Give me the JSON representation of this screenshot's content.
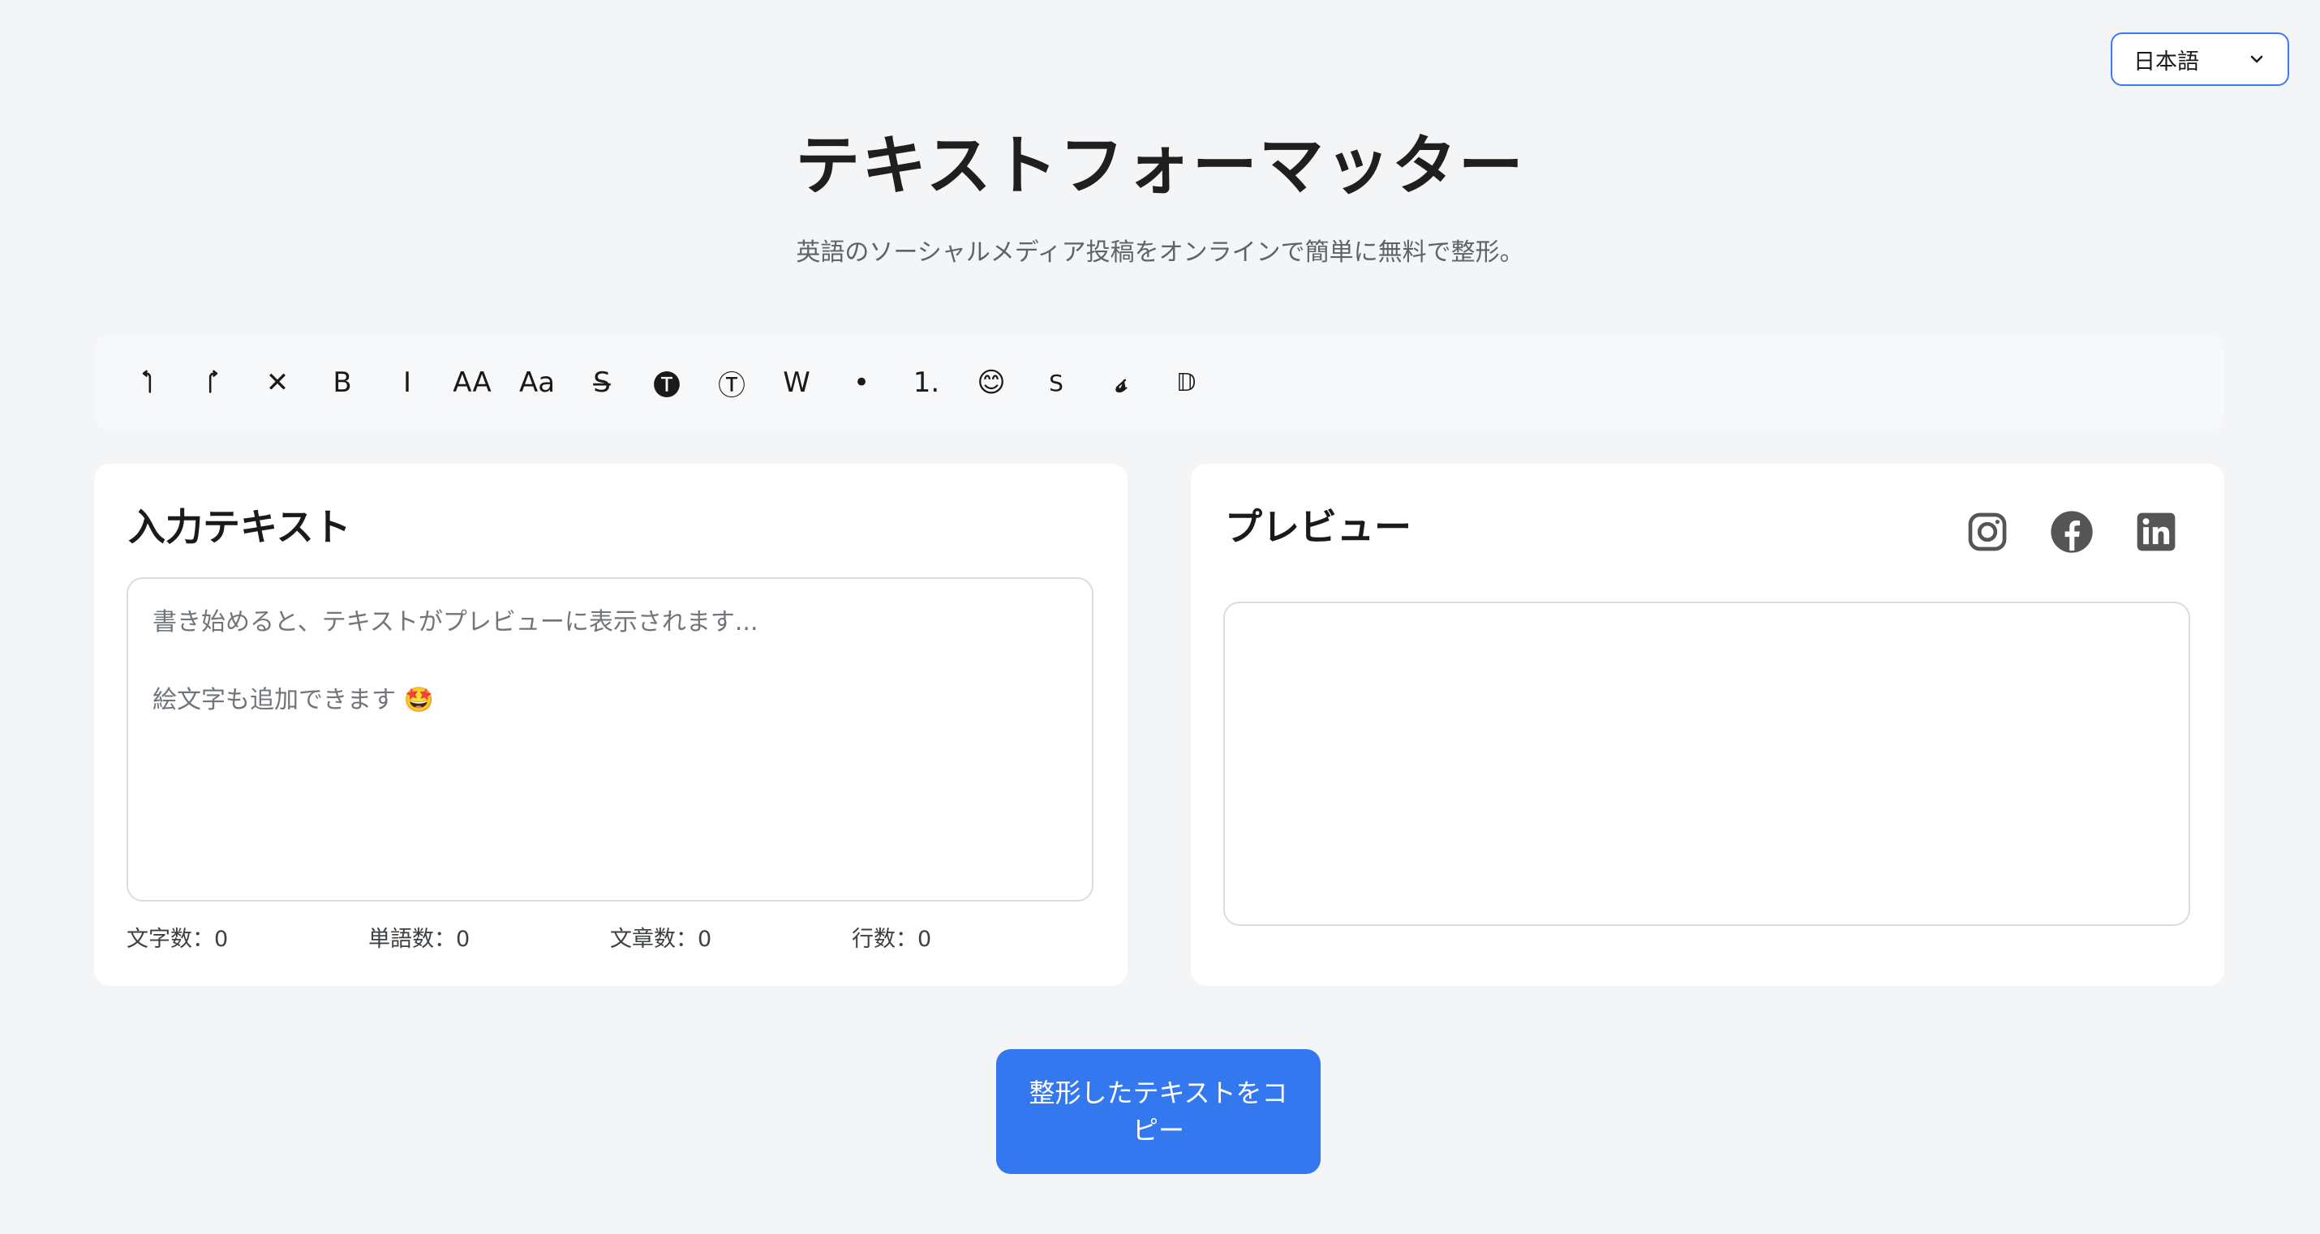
{
  "language": {
    "selected": "日本語"
  },
  "header": {
    "title": "テキストフォーマッター",
    "subtitle": "英語のソーシャルメディア投稿をオンラインで簡単に無料で整形。"
  },
  "toolbar": {
    "undo": "↰",
    "redo": "↱",
    "clear": "✕",
    "bold": "B",
    "italic": "I",
    "uppercase": "AA",
    "capitalize": "Aa",
    "strikethrough": "S̶",
    "circled_black": "🅣",
    "circled": "Ⓣ",
    "wide": "W",
    "bullet": "•",
    "numbered": "1.",
    "emoji": "😊",
    "small_caps": "S",
    "script": "𝓼",
    "double_struck": "𝔻"
  },
  "input": {
    "title": "入力テキスト",
    "placeholder_line1": "書き始めると、テキストがプレビューに表示されます...",
    "placeholder_line2": "絵文字も追加できます 🤩",
    "stats": {
      "characters": "文字数：0",
      "words": "単語数：0",
      "sentences": "文章数：0",
      "lines": "行数：0"
    }
  },
  "preview": {
    "title": "プレビュー"
  },
  "copy_button": {
    "label": "整形したテキストをコピー"
  },
  "colors": {
    "accent": "#3478f0",
    "background": "#f4f5f7",
    "icon": "#555555"
  }
}
